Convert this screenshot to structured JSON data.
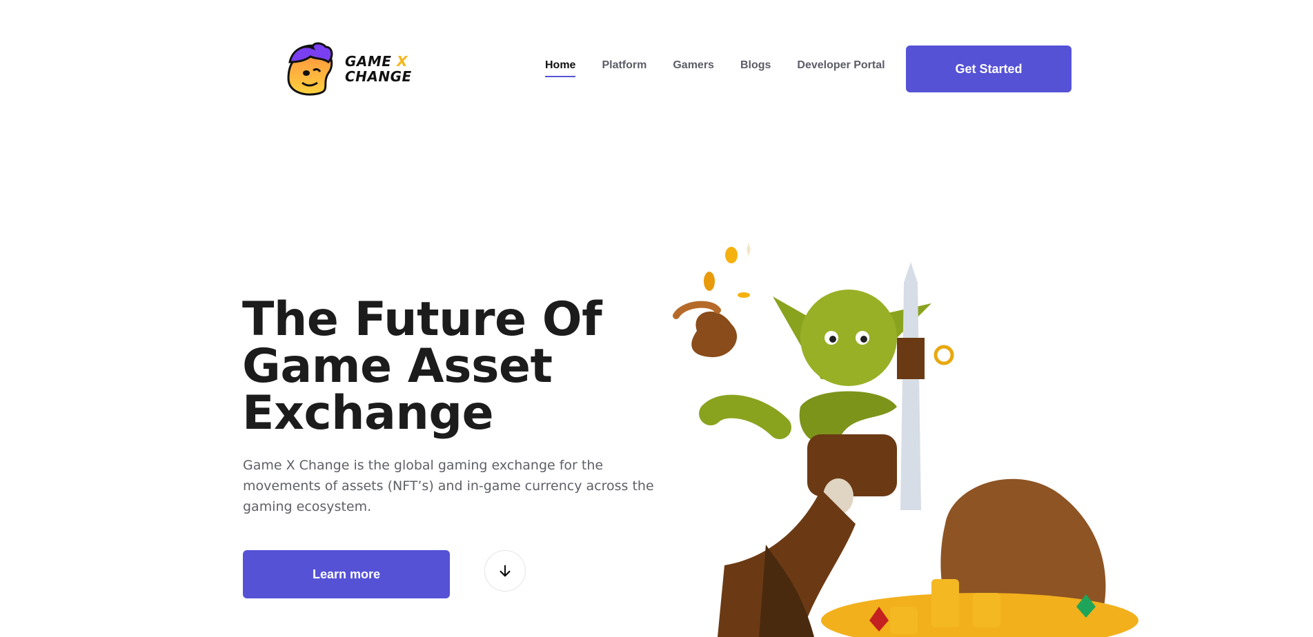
{
  "brand": {
    "line1": "GAME",
    "x": "X",
    "line2": "CHANGE"
  },
  "nav": {
    "items": [
      {
        "label": "Home",
        "active": true
      },
      {
        "label": "Platform",
        "active": false
      },
      {
        "label": "Gamers",
        "active": false
      },
      {
        "label": "Blogs",
        "active": false
      },
      {
        "label": "Developer Portal",
        "active": false
      }
    ],
    "cta_label": "Get Started"
  },
  "hero": {
    "title_line1": "The Future Of",
    "title_line2": "Game Asset",
    "title_line3": "Exchange",
    "description": "Game X Change is the global gaming exchange for the movements of assets (NFT’s) and in-game currency across the gaming ecosystem.",
    "learn_more_label": "Learn more",
    "scroll_icon": "arrow-down-icon"
  },
  "colors": {
    "accent": "#5552d6",
    "logo_yellow": "#f6b71e",
    "text_dark": "#1c1c1c",
    "text_muted": "#5e6066"
  }
}
